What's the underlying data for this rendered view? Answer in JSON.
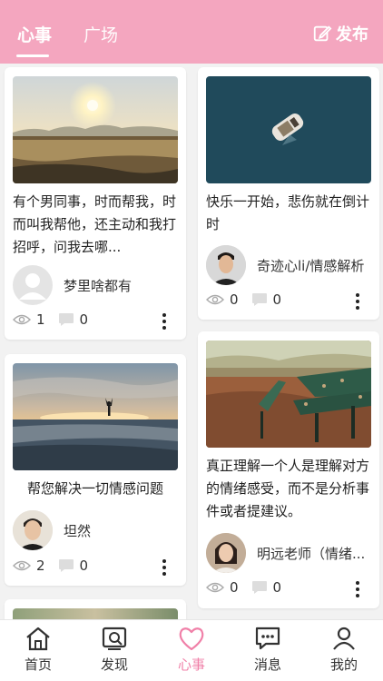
{
  "header": {
    "tabs": [
      {
        "label": "心事",
        "active": true
      },
      {
        "label": "广场",
        "active": false
      }
    ],
    "publish_label": "发布",
    "bg_color": "#f4a6bf"
  },
  "feed": {
    "left": [
      {
        "text": "有个男同事，时而帮我，时而叫我帮他，还主动和我打招呼，问我去哪...",
        "author": "梦里啥都有",
        "views": "1",
        "comments": "0",
        "image": "sunrise-field"
      },
      {
        "text": "帮您解决一切情感问题",
        "author": "坦然",
        "views": "2",
        "comments": "0",
        "image": "sunset-beach"
      }
    ],
    "right": [
      {
        "text": "快乐一开始，悲伤就在倒计时",
        "author": "奇迹心li/情感解析",
        "views": "0",
        "comments": "0",
        "image": "boat-aerial"
      },
      {
        "text": "真正理解一个人是理解对方的情绪感受，而不是分析事件或者提建议。",
        "author": "明远老师（情绪...",
        "views": "0",
        "comments": "0",
        "image": "autumn-bench"
      }
    ]
  },
  "bottom_nav": [
    {
      "label": "首页",
      "icon": "home-icon",
      "active": false
    },
    {
      "label": "发现",
      "icon": "discover-icon",
      "active": false
    },
    {
      "label": "心事",
      "icon": "heart-icon",
      "active": true
    },
    {
      "label": "消息",
      "icon": "message-icon",
      "active": false
    },
    {
      "label": "我的",
      "icon": "profile-icon",
      "active": false
    }
  ],
  "colors": {
    "accent": "#f080a8"
  }
}
